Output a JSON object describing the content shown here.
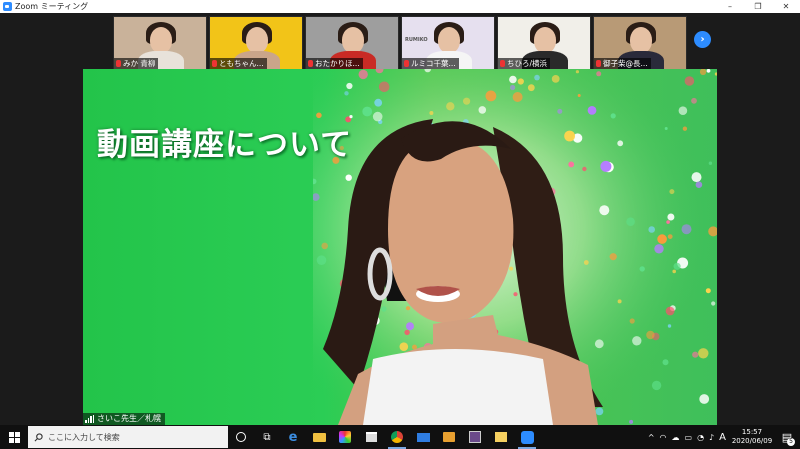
{
  "window": {
    "title": "Zoom ミーティング",
    "controls": [
      "–",
      "❐",
      "✕"
    ]
  },
  "participants": [
    {
      "name": "みか 青柳",
      "bg": "#c9b29a",
      "shirt": "#e8e2da"
    },
    {
      "name": "ともちゃん...",
      "bg": "#f2c418",
      "shirt": "#caa58a"
    },
    {
      "name": "おたかりほ...",
      "bg": "#9e9e9e",
      "shirt": "#c92b25"
    },
    {
      "name": "ルミコ千葉...",
      "bg": "#e6e0ef",
      "shirt": "#f5f5f5",
      "logo_text": "RUMIKO"
    },
    {
      "name": "ちひろ/横浜",
      "bg": "#f1efe9",
      "shirt": "#2a2a2a"
    },
    {
      "name": "御子柴@長...",
      "bg": "#b89a76",
      "shirt": "#2a2a3a"
    }
  ],
  "main_video": {
    "headline": "動画講座について",
    "speaker_label": "さいこ先生／札幌",
    "bg_color": "#2bcd55"
  },
  "taskbar": {
    "search_placeholder": "ここに入力して検索",
    "apps": [
      "task-view-icon",
      "edge-icon",
      "explorer-icon",
      "photos-icon",
      "store-icon",
      "chrome-icon",
      "mail-icon",
      "media-icon",
      "app-icon",
      "folder-icon",
      "zoom-icon"
    ],
    "tray_ime": "A",
    "time": "15:57",
    "date": "2020/06/09",
    "notification_count": "5"
  }
}
